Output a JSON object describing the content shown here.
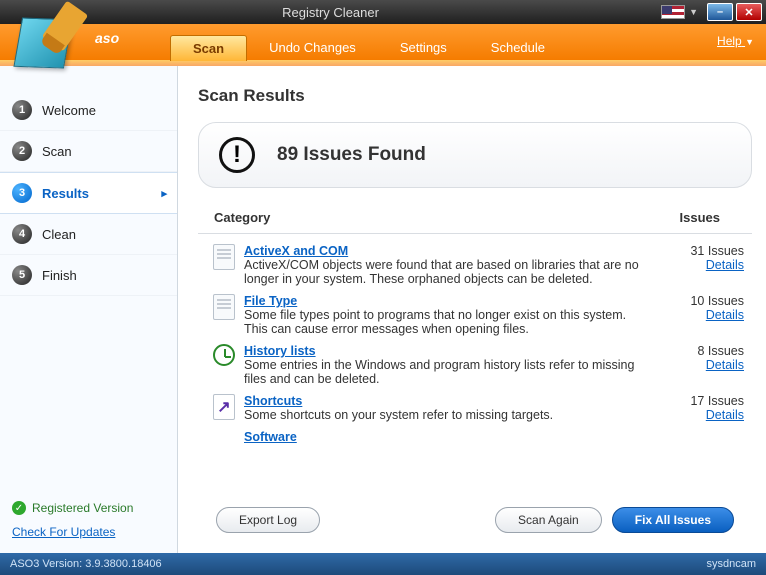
{
  "window": {
    "title": "Registry Cleaner",
    "help_label": "Help"
  },
  "brand": "aso",
  "tabs": [
    {
      "label": "Scan",
      "active": true
    },
    {
      "label": "Undo Changes",
      "active": false
    },
    {
      "label": "Settings",
      "active": false
    },
    {
      "label": "Schedule",
      "active": false
    }
  ],
  "sidebar": {
    "steps": [
      {
        "num": "1",
        "label": "Welcome"
      },
      {
        "num": "2",
        "label": "Scan"
      },
      {
        "num": "3",
        "label": "Results"
      },
      {
        "num": "4",
        "label": "Clean"
      },
      {
        "num": "5",
        "label": "Finish"
      }
    ],
    "active_index": 2,
    "registered_label": "Registered Version",
    "updates_label": "Check For Updates"
  },
  "main": {
    "page_title": "Scan Results",
    "summary": "89 Issues Found",
    "headers": {
      "category": "Category",
      "issues": "Issues"
    },
    "details_label": "Details",
    "issues_suffix": "Issues",
    "categories": [
      {
        "name": "ActiveX and COM",
        "count": 31,
        "desc": "ActiveX/COM objects were found that are based on libraries that are no longer in your system. These orphaned objects can be deleted."
      },
      {
        "name": "File Type",
        "count": 10,
        "desc": "Some file types point to programs that no longer exist on this system. This can cause error messages when opening files."
      },
      {
        "name": "History lists",
        "count": 8,
        "desc": "Some entries in the Windows and program history lists refer to missing files and can be deleted."
      },
      {
        "name": "Shortcuts",
        "count": 17,
        "desc": "Some shortcuts on your system refer to missing targets."
      },
      {
        "name": "Software",
        "count": null,
        "desc": ""
      }
    ],
    "buttons": {
      "export": "Export Log",
      "scan_again": "Scan Again",
      "fix": "Fix All Issues"
    }
  },
  "status": {
    "version_label": "ASO3 Version: 3.9.3800.18406",
    "watermark": "sysdncam"
  }
}
